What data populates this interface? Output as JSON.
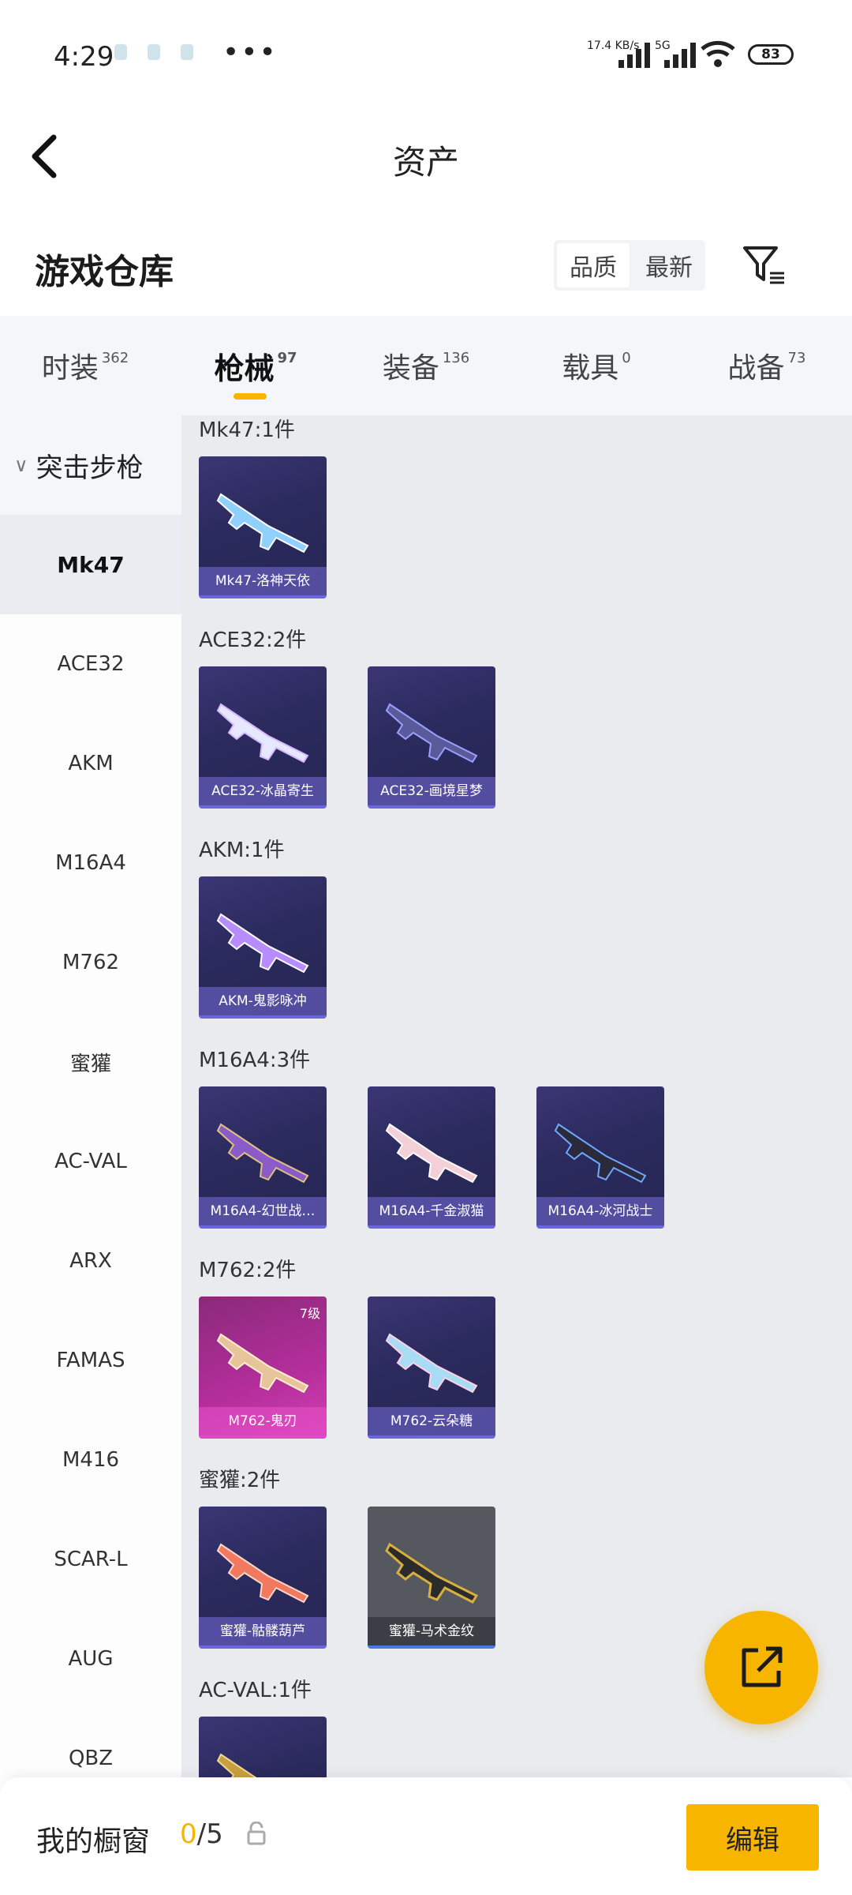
{
  "status_bar": {
    "time": "4:29",
    "net_speed": "17.4 KB/s",
    "gen": "5G",
    "battery": "83"
  },
  "header": {
    "title": "资产",
    "section_title": "游戏仓库",
    "sort_options": [
      "品质",
      "最新"
    ]
  },
  "tabs": [
    {
      "label": "时装",
      "count": "362"
    },
    {
      "label": "枪械",
      "count": "97"
    },
    {
      "label": "装备",
      "count": "136"
    },
    {
      "label": "载具",
      "count": "0"
    },
    {
      "label": "战备",
      "count": "73"
    }
  ],
  "rail": {
    "group": "突击步枪",
    "items": [
      "Mk47",
      "ACE32",
      "AKM",
      "M16A4",
      "M762",
      "蜜獾",
      "AC-VAL",
      "ARX",
      "FAMAS",
      "M416",
      "SCAR-L",
      "AUG",
      "QBZ"
    ]
  },
  "sections": [
    {
      "label": "Mk47:1件",
      "cards": [
        "Mk47-洛神天依"
      ]
    },
    {
      "label": "ACE32:2件",
      "cards": [
        "ACE32-冰晶寄生",
        "ACE32-画境星梦"
      ]
    },
    {
      "label": "AKM:1件",
      "cards": [
        "AKM-鬼影咏冲"
      ]
    },
    {
      "label": "M16A4:3件",
      "cards": [
        "M16A4-幻世战…",
        "M16A4-千金淑猫",
        "M16A4-冰河战士"
      ]
    },
    {
      "label": "M762:2件",
      "cards": [
        "M762-鬼刃",
        "M762-云朵糖"
      ],
      "level": "7级"
    },
    {
      "label": "蜜獾:2件",
      "cards": [
        "蜜獾-骷髅葫芦",
        "蜜獾-马术金纹"
      ]
    },
    {
      "label": "AC-VAL:1件",
      "cards": [
        ""
      ]
    }
  ],
  "bottom": {
    "label": "我的橱窗",
    "count_current": "0",
    "count_total": "/5",
    "edit": "编辑"
  },
  "colors": {
    "accent": "#f7b500",
    "card_dark": "#2b2a5d",
    "card_pink": "#b42e9b"
  }
}
